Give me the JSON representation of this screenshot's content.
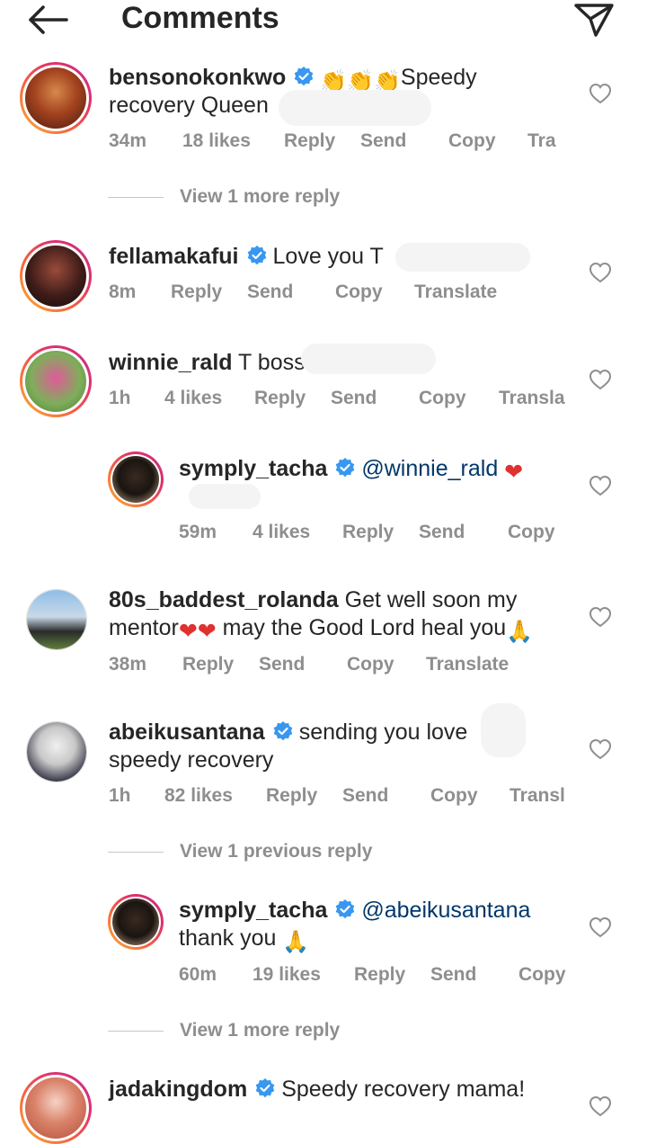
{
  "header": {
    "title": "Comments"
  },
  "colors": {
    "text": "#262626",
    "meta": "#8e8e8e",
    "verified": "#3897f0",
    "mention": "#00376b",
    "heart_emoji": "#e0302f"
  },
  "comments": [
    {
      "username": "bensonokonkwo",
      "line1_text": "Speedy",
      "line2_text": "recovery Queen",
      "time": "34m",
      "likes": "18 likes",
      "reply": "Reply",
      "send": "Send",
      "copy": "Copy",
      "translate": "Tra",
      "view_replies": "View 1 more reply"
    },
    {
      "username": "fellamakafui",
      "text": "Love you T",
      "time": "8m",
      "reply": "Reply",
      "send": "Send",
      "copy": "Copy",
      "translate": "Translate"
    },
    {
      "username": "winnie_rald",
      "text": "T boss",
      "time": "1h",
      "likes": "4 likes",
      "reply": "Reply",
      "send": "Send",
      "copy": "Copy",
      "translate": "Transla",
      "reply_item": {
        "username": "symply_tacha",
        "mention": "@winnie_rald",
        "time": "59m",
        "likes": "4 likes",
        "reply": "Reply",
        "send": "Send",
        "copy": "Copy"
      }
    },
    {
      "username": "80s_baddest_rolanda",
      "line1_text": "Get well soon my",
      "line2_text_a": "mentor",
      "line2_text_b": "may the Good Lord heal you",
      "time": "38m",
      "reply": "Reply",
      "send": "Send",
      "copy": "Copy",
      "translate": "Translate"
    },
    {
      "username": "abeikusantana",
      "line1_text": "sending you love",
      "line2_text": "speedy recovery",
      "time": "1h",
      "likes": "82 likes",
      "reply": "Reply",
      "send": "Send",
      "copy": "Copy",
      "translate": "Transl",
      "view_previous": "View 1 previous reply",
      "reply_item": {
        "username": "symply_tacha",
        "mention": "@abeikusantana",
        "line2_text": "thank you",
        "time": "60m",
        "likes": "19 likes",
        "reply": "Reply",
        "send": "Send",
        "copy": "Copy"
      },
      "view_replies": "View 1 more reply"
    },
    {
      "username": "jadakingdom",
      "text": "Speedy recovery mama!"
    }
  ]
}
